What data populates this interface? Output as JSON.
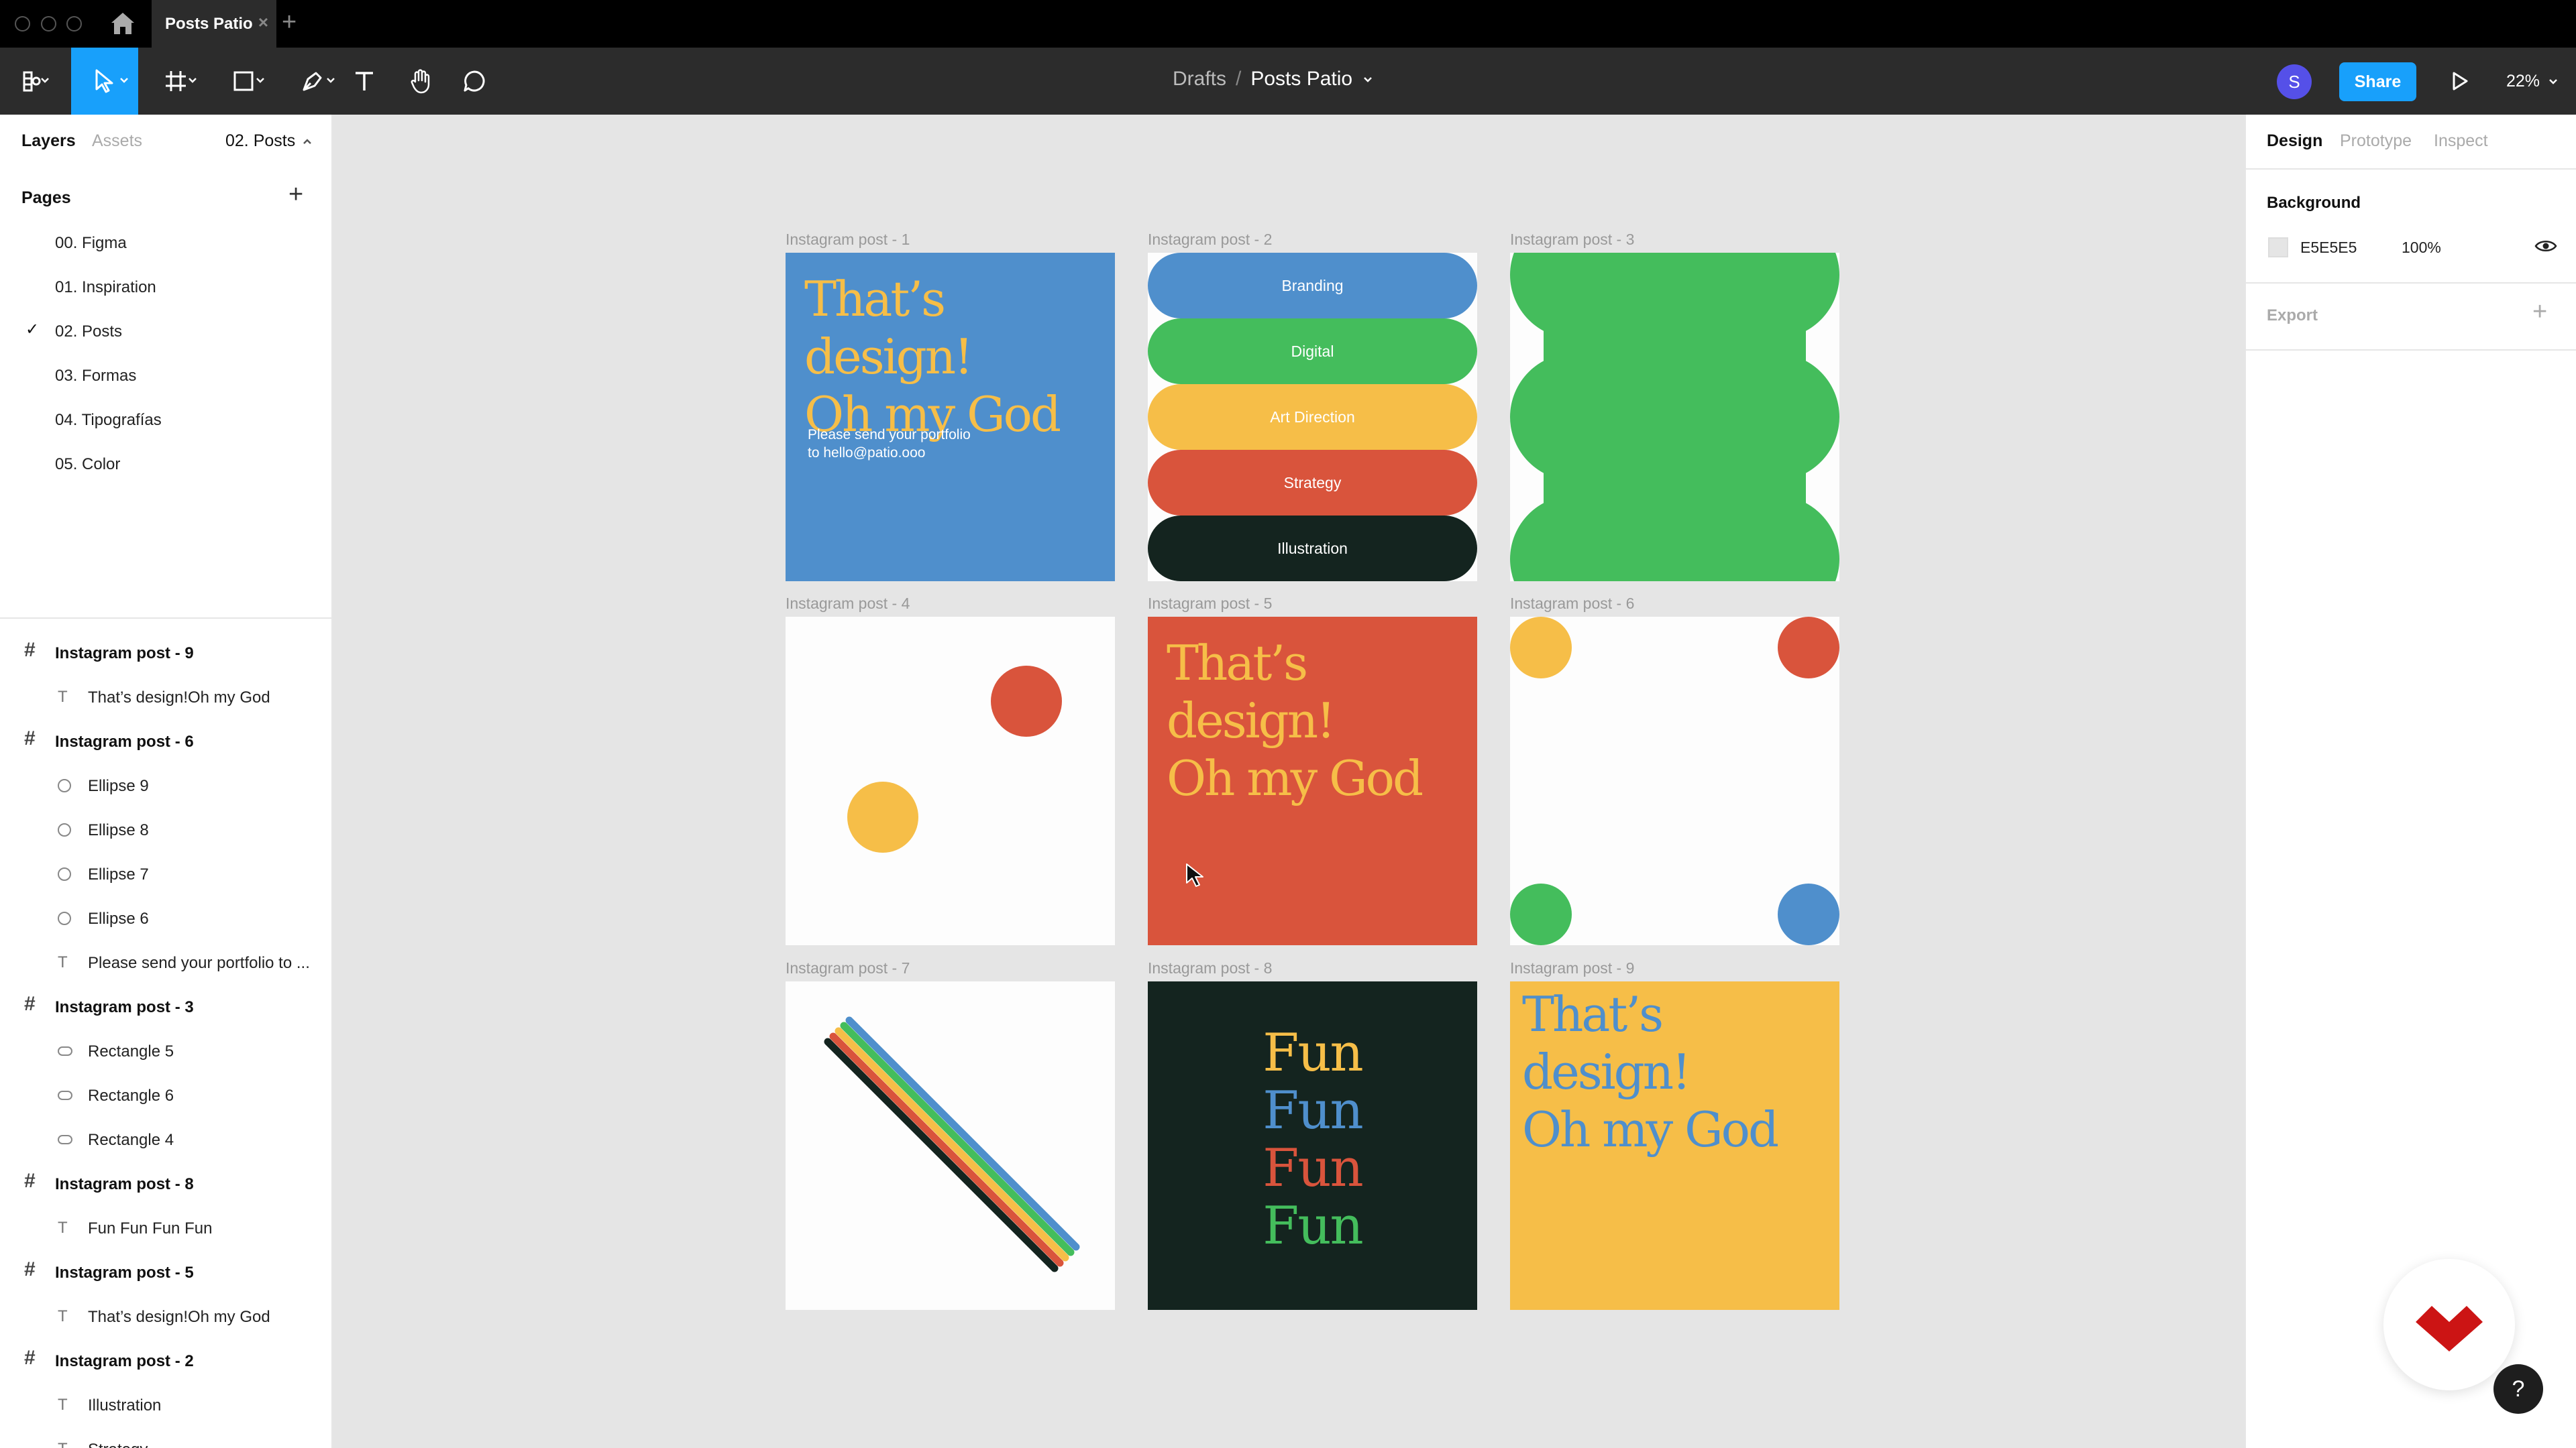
{
  "window": {
    "active_tab": "Posts Patio",
    "close_glyph": "×",
    "add_glyph": "+"
  },
  "toolbar": {
    "breadcrumb_parent": "Drafts",
    "breadcrumb_separator": "/",
    "file_name": "Posts Patio",
    "avatar_initial": "S",
    "share_label": "Share",
    "zoom": "22%",
    "active_tool": "move",
    "accent": "#18a0fb"
  },
  "left_panel": {
    "tabs": [
      "Layers",
      "Assets"
    ],
    "current_page": "02. Posts",
    "pages_heading": "Pages",
    "pages": [
      {
        "label": "00. Figma",
        "selected": false
      },
      {
        "label": "01. Inspiration",
        "selected": false
      },
      {
        "label": "02. Posts",
        "selected": true
      },
      {
        "label": "03. Formas",
        "selected": false
      },
      {
        "label": "04. Tipografías",
        "selected": false
      },
      {
        "label": "05. Color",
        "selected": false
      }
    ],
    "layers": [
      {
        "type": "frame",
        "name": "Instagram post - 9"
      },
      {
        "type": "text",
        "name": "That’s design!Oh my God"
      },
      {
        "type": "frame",
        "name": "Instagram post - 6"
      },
      {
        "type": "ellipse",
        "name": "Ellipse 9"
      },
      {
        "type": "ellipse",
        "name": "Ellipse 8"
      },
      {
        "type": "ellipse",
        "name": "Ellipse 7"
      },
      {
        "type": "ellipse",
        "name": "Ellipse 6"
      },
      {
        "type": "text",
        "name": "Please send your portfolio to ..."
      },
      {
        "type": "frame",
        "name": "Instagram post - 3"
      },
      {
        "type": "rectangle",
        "name": "Rectangle 5"
      },
      {
        "type": "rectangle",
        "name": "Rectangle 6"
      },
      {
        "type": "rectangle",
        "name": "Rectangle 4"
      },
      {
        "type": "frame",
        "name": "Instagram post - 8"
      },
      {
        "type": "text",
        "name": "Fun Fun Fun Fun"
      },
      {
        "type": "frame",
        "name": "Instagram post - 5"
      },
      {
        "type": "text",
        "name": "That’s design!Oh my God"
      },
      {
        "type": "frame",
        "name": "Instagram post - 2"
      },
      {
        "type": "text",
        "name": "Illustration"
      },
      {
        "type": "text",
        "name": "Strategy"
      }
    ]
  },
  "right_panel": {
    "tabs": [
      "Design",
      "Prototype",
      "Inspect"
    ],
    "background_heading": "Background",
    "background_hex": "E5E5E5",
    "background_opacity": "100%",
    "export_heading": "Export"
  },
  "canvas": {
    "background": "#e5e5e5",
    "colors": {
      "blue": "#4f8fcc",
      "green": "#44bd5c",
      "yellow": "#f6be48",
      "red": "#d9543c",
      "dark": "#14241f",
      "white": "#fdfdfd"
    },
    "post1": {
      "label": "Instagram post - 1",
      "headline_line1": "That’s design!",
      "headline_line2": "Oh my God",
      "body_line1": "Please send your portfolio",
      "body_line2": "to hello@patio.ooo"
    },
    "post2": {
      "label": "Instagram post - 2",
      "pills": [
        "Branding",
        "Digital",
        "Art Direction",
        "Strategy",
        "Illustration"
      ]
    },
    "post3": {
      "label": "Instagram post - 3"
    },
    "post4": {
      "label": "Instagram post - 4"
    },
    "post5": {
      "label": "Instagram post - 5",
      "headline_line1": "That’s design!",
      "headline_line2": "Oh my God"
    },
    "post6": {
      "label": "Instagram post - 6"
    },
    "post7": {
      "label": "Instagram post - 7"
    },
    "post8": {
      "label": "Instagram post - 8",
      "words": [
        "Fun",
        "Fun",
        "Fun",
        "Fun"
      ]
    },
    "post9": {
      "label": "Instagram post - 9",
      "headline_line1": "That’s design!",
      "headline_line2": "Oh my God"
    }
  },
  "widgets": {
    "help_label": "?"
  }
}
